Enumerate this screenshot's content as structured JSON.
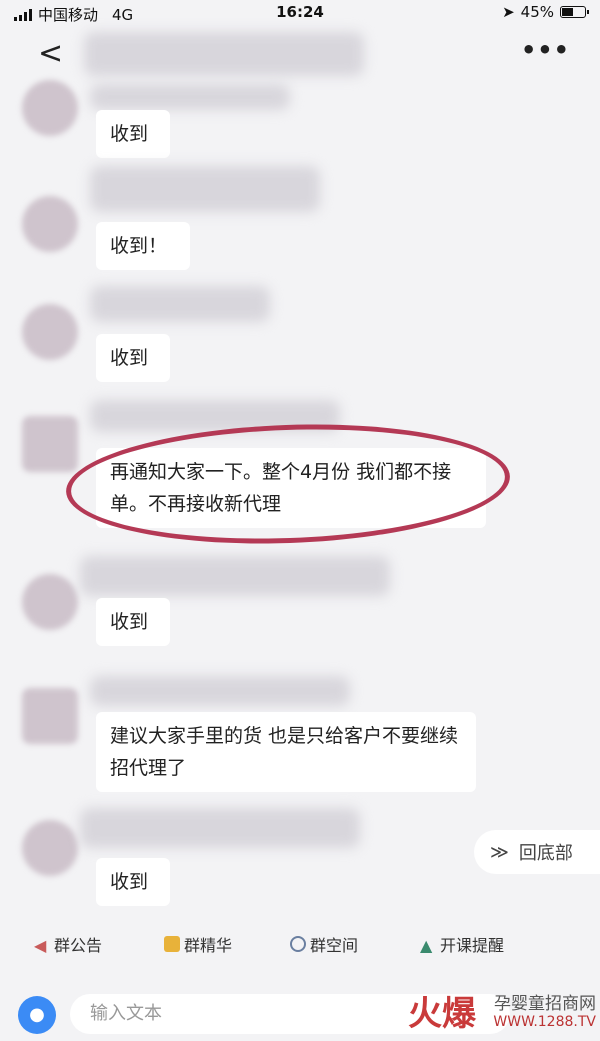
{
  "status_bar": {
    "carrier": "中国移动",
    "network": "4G",
    "time": "16:24",
    "battery": "45%"
  },
  "nav": {
    "back": "<",
    "more": "•••"
  },
  "messages": [
    {
      "text": "收到"
    },
    {
      "text": "收到！"
    },
    {
      "text": "收到"
    },
    {
      "text": "再通知大家一下。整个4月份  我们都不接单。不再接收新代理",
      "highlighted": true
    },
    {
      "text": "收到"
    },
    {
      "text": "建议大家手里的货  也是只给客户不要继续招代理了"
    },
    {
      "text": "收到"
    }
  ],
  "scroll_to_bottom": {
    "label": "回底部"
  },
  "group_tabs": [
    {
      "label": "群公告",
      "icon": "speaker-icon"
    },
    {
      "label": "群精华",
      "icon": "star-badge-icon"
    },
    {
      "label": "群空间",
      "icon": "space-icon"
    },
    {
      "label": "开课提醒",
      "icon": "bell-icon"
    }
  ],
  "input": {
    "placeholder": "输入文本"
  },
  "watermark": {
    "brand": "火爆",
    "site_name": "孕婴童招商网",
    "url": "WWW.1288.TV"
  },
  "colors": {
    "highlight": "#b43955",
    "accent": "#3b8bf5",
    "background": "#f3f3f5"
  }
}
